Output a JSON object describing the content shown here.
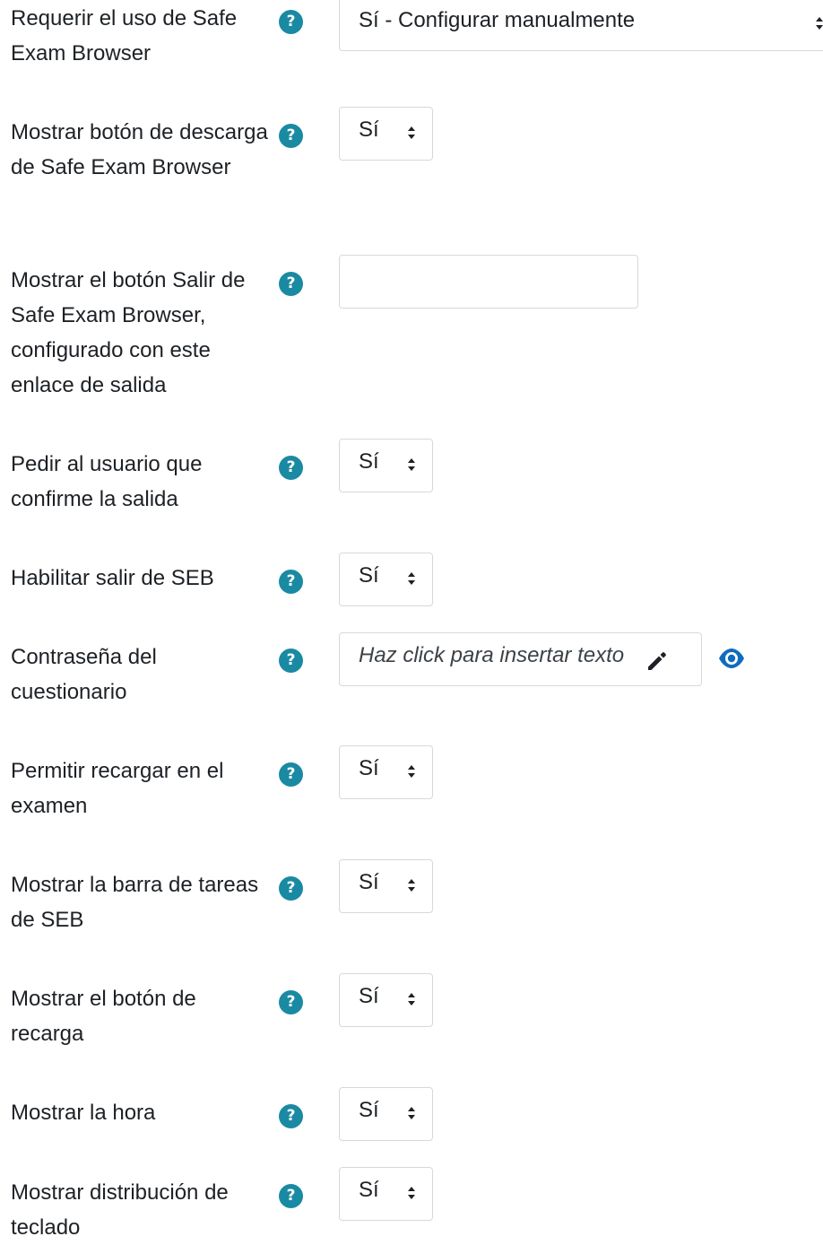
{
  "fields": [
    {
      "label": "Requerir el uso de Safe Exam Browser",
      "value": "Sí - Configurar manualmente",
      "help_icon": "question-circle-icon"
    },
    {
      "label": "Mostrar botón de descarga de Safe Exam Browser",
      "value": "Sí",
      "help_icon": "question-circle-icon"
    },
    {
      "label": "Mostrar el botón Salir de Safe Exam Browser, configurado con este enlace de salida",
      "value": "",
      "help_icon": "question-circle-icon"
    },
    {
      "label": "Pedir al usuario que confirme la salida",
      "value": "Sí",
      "help_icon": "question-circle-icon"
    },
    {
      "label": "Habilitar salir de SEB",
      "value": "Sí",
      "help_icon": "question-circle-icon"
    },
    {
      "label": "Contraseña del cuestionario",
      "placeholder": "Haz click para insertar texto",
      "edit_icon": "pencil-icon",
      "reveal_icon": "eye-icon",
      "help_icon": "question-circle-icon"
    },
    {
      "label": "Permitir recargar en el examen",
      "value": "Sí",
      "help_icon": "question-circle-icon"
    },
    {
      "label": "Mostrar la barra de tareas de SEB",
      "value": "Sí",
      "help_icon": "question-circle-icon"
    },
    {
      "label": "Mostrar el botón de recarga",
      "value": "Sí",
      "help_icon": "question-circle-icon"
    },
    {
      "label": "Mostrar la hora",
      "value": "Sí",
      "help_icon": "question-circle-icon"
    },
    {
      "label": "Mostrar distribución de teclado",
      "value": "Sí",
      "help_icon": "question-circle-icon"
    }
  ],
  "help_glyph": "?",
  "colors": {
    "help_icon": "#1a8aa3",
    "eye_icon": "#0f6cbf",
    "text": "#1d2125",
    "border": "#d5d8dc"
  }
}
